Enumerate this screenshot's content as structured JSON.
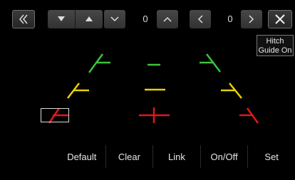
{
  "toolbar": {
    "value_1": "0",
    "value_2": "0"
  },
  "hitch_button": {
    "label_1": "Hitch",
    "label_2": "Guide On"
  },
  "bottom_bar": {
    "default_label": "Default",
    "clear_label": "Clear",
    "link_label": "Link",
    "onoff_label": "On/Off",
    "set_label": "Set"
  },
  "colors": {
    "green": "#3cc23c",
    "yellow": "#e8d000",
    "red": "#e01818"
  },
  "icons": [
    "back-double-chevron-icon",
    "triangle-down-icon",
    "triangle-up-icon",
    "chevron-down-icon",
    "chevron-up-icon",
    "chevron-left-icon",
    "chevron-right-icon",
    "close-icon"
  ]
}
